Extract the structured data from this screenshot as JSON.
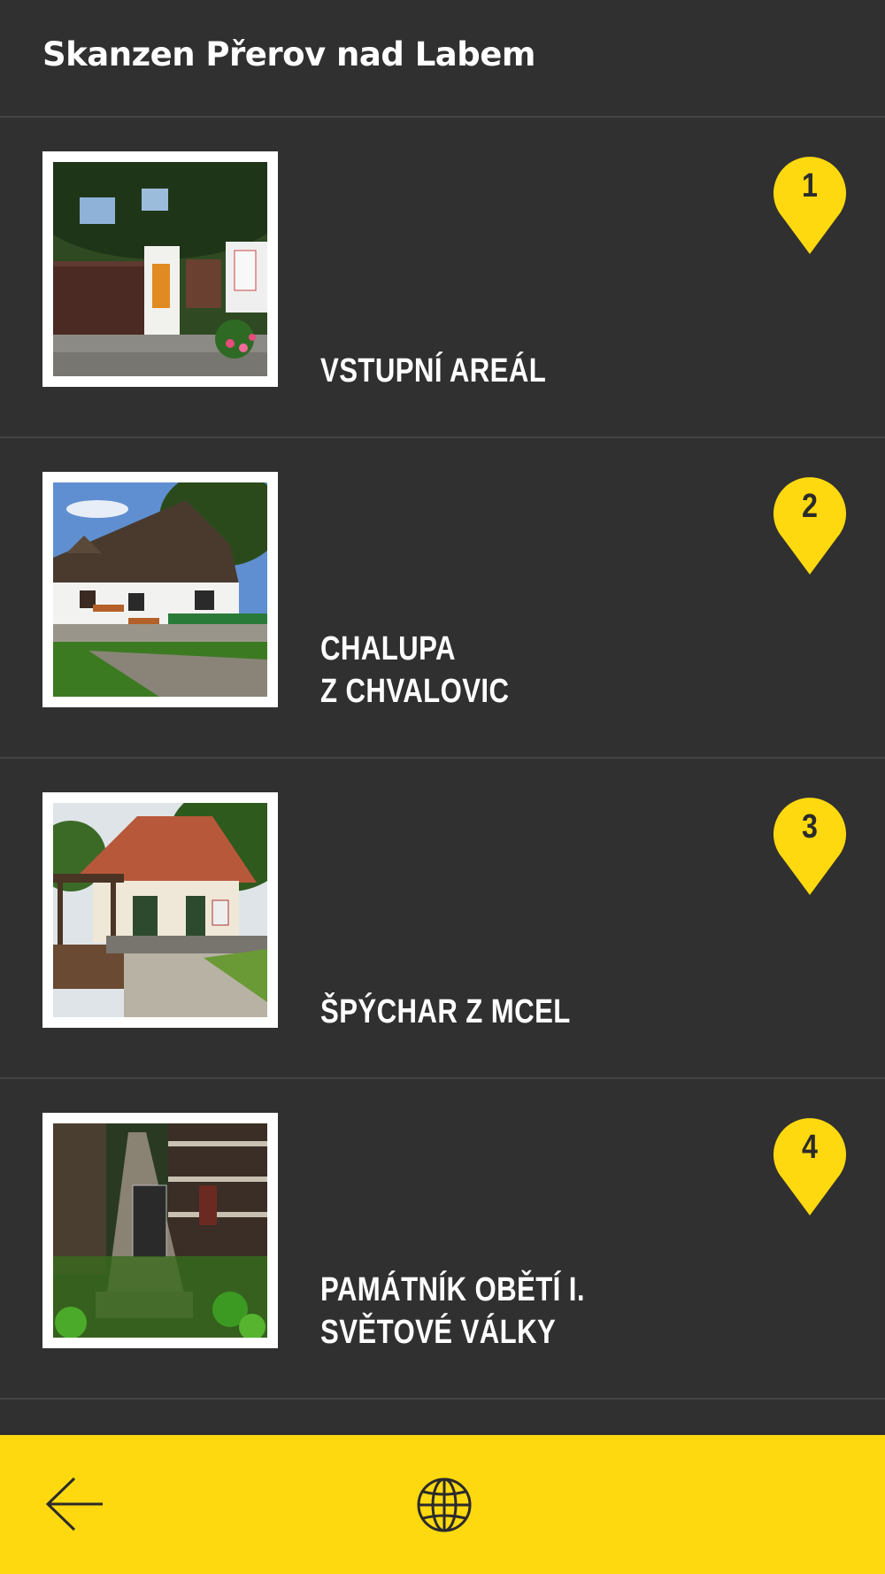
{
  "header": {
    "title": "Skanzen Přerov nad Labem"
  },
  "items": [
    {
      "number": "1",
      "title": "VSTUPNÍ AREÁL",
      "photo_icon": "entrance-gate-photo"
    },
    {
      "number": "2",
      "title": "CHALUPA\nZ CHVALOVIC",
      "photo_icon": "cottage-photo"
    },
    {
      "number": "3",
      "title": "ŠPÝCHAR Z MCEL",
      "photo_icon": "granary-photo"
    },
    {
      "number": "4",
      "title": "PAMÁTNÍK OBĚTÍ I.\nSVĚTOVÉ VÁLKY",
      "photo_icon": "memorial-photo"
    }
  ],
  "bottom_bar": {
    "back_icon": "arrow-left-icon",
    "language_icon": "globe-icon"
  },
  "colors": {
    "background": "#303030",
    "accent": "#ffd90f",
    "text": "#ffffff",
    "divider": "#444444"
  }
}
